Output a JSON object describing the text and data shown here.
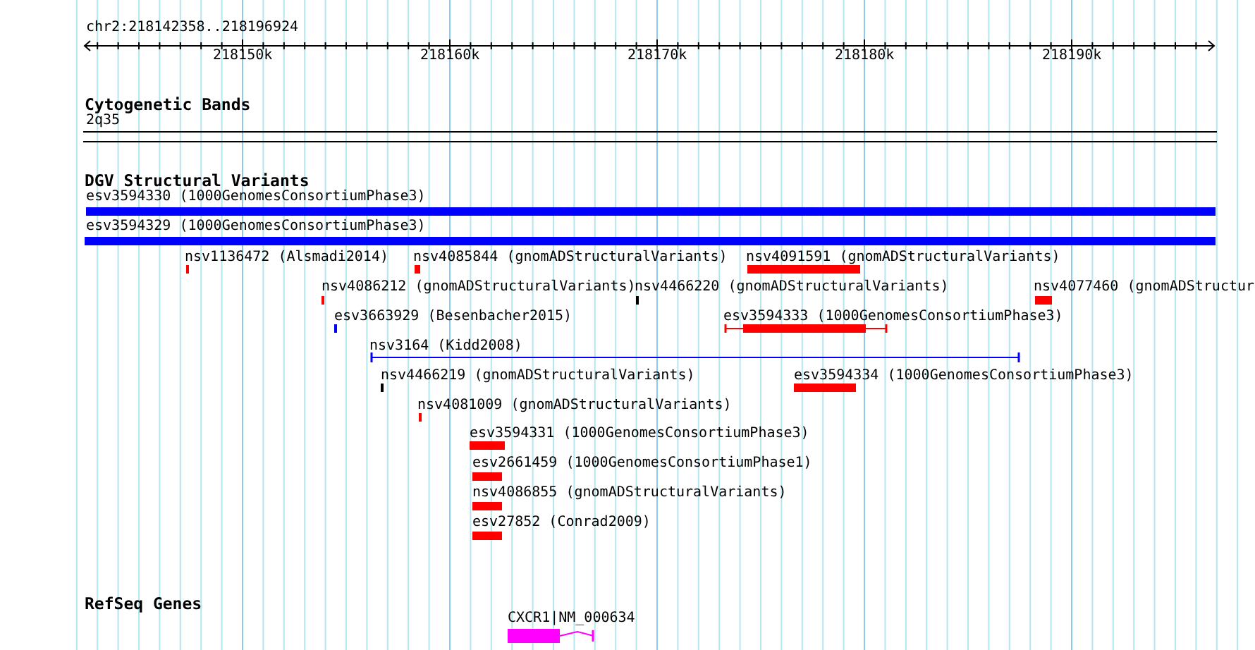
{
  "ruler": {
    "location": "chr2:218142358..218196924",
    "ticks": [
      "218150k",
      "218160k",
      "218170k",
      "218180k",
      "218190k"
    ]
  },
  "tracks": [
    {
      "kind": "cytoband",
      "title": "Cytogenetic Bands",
      "features": [
        {
          "label": "2q35"
        }
      ]
    },
    {
      "kind": "variants",
      "title": "DGV Structural Variants",
      "features": [
        {
          "label": "esv3594330 (1000GenomesConsortiumPhase3)",
          "kind": "bar",
          "color": "#0000ff"
        },
        {
          "label": "esv3594329 (1000GenomesConsortiumPhase3)",
          "kind": "bar",
          "color": "#0000ff"
        },
        {
          "label": "nsv1136472 (Alsmadi2014)",
          "kind": "bar",
          "color": "#ff0000"
        },
        {
          "label": "nsv4085844 (gnomADStructuralVariants)",
          "kind": "bar",
          "color": "#ff0000"
        },
        {
          "label": "nsv4091591 (gnomADStructuralVariants)",
          "kind": "bar",
          "color": "#ff0000"
        },
        {
          "label": "nsv4086212 (gnomADStructuralVariants)",
          "kind": "bar",
          "color": "#ff0000"
        },
        {
          "label": "nsv4466220 (gnomADStructuralVariants)",
          "kind": "bar",
          "color": "#000000"
        },
        {
          "label": "nsv4077460 (gnomADStructur",
          "kind": "bar",
          "color": "#ff0000"
        },
        {
          "label": "esv3663929 (Besenbacher2015)",
          "kind": "bar",
          "color": "#0000ff"
        },
        {
          "label": "esv3594333 (1000GenomesConsortiumPhase3)",
          "kind": "bar-span",
          "color": "#ff0000"
        },
        {
          "label": "nsv3164 (Kidd2008)",
          "kind": "span",
          "color": "#0000ff"
        },
        {
          "label": "nsv4466219 (gnomADStructuralVariants)",
          "kind": "bar",
          "color": "#000000"
        },
        {
          "label": "esv3594334 (1000GenomesConsortiumPhase3)",
          "kind": "bar",
          "color": "#ff0000"
        },
        {
          "label": "nsv4081009 (gnomADStructuralVariants)",
          "kind": "bar",
          "color": "#ff0000"
        },
        {
          "label": "esv3594331 (1000GenomesConsortiumPhase3)",
          "kind": "bar",
          "color": "#ff0000"
        },
        {
          "label": "esv2661459 (1000GenomesConsortiumPhase1)",
          "kind": "bar",
          "color": "#ff0000"
        },
        {
          "label": "nsv4086855 (gnomADStructuralVariants)",
          "kind": "bar",
          "color": "#ff0000"
        },
        {
          "label": "esv27852 (Conrad2009)",
          "kind": "bar",
          "color": "#ff0000"
        }
      ]
    },
    {
      "kind": "genes",
      "title": "RefSeq Genes",
      "features": [
        {
          "label": "CXCR1|NM_000634",
          "kind": "gene",
          "color": "#ff00ff"
        }
      ]
    }
  ]
}
